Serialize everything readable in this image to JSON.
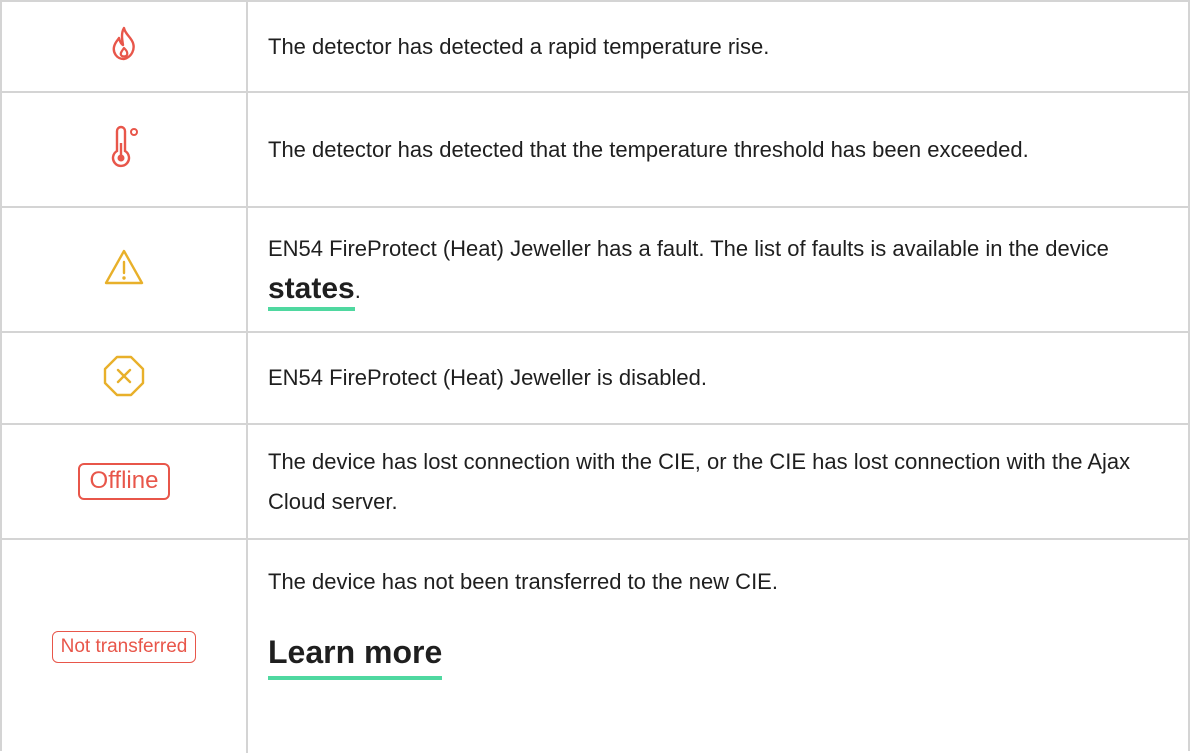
{
  "colors": {
    "red": "#e8564a",
    "yellow": "#e8b02a",
    "link_underline": "#4fd8a0",
    "border": "#d4d4d4"
  },
  "rows": [
    {
      "icon": "flame-icon",
      "text": "The detector has detected a rapid temperature rise."
    },
    {
      "icon": "thermometer-icon",
      "text": "The detector has detected that the temperature threshold has been exceeded."
    },
    {
      "icon": "warning-triangle-icon",
      "text_before": "EN54 FireProtect (Heat) Jeweller has a fault. The list of faults is available in the device ",
      "link": "states",
      "text_after": "."
    },
    {
      "icon": "disabled-octagon-icon",
      "text": "EN54 FireProtect (Heat) Jeweller is disabled."
    },
    {
      "badge": "Offline",
      "text": "The device has lost connection with the CIE, or the CIE has lost connection with the Ajax Cloud server."
    },
    {
      "badge": "Not transferred",
      "text": "The device has not been transferred to the new CIE.",
      "link": "Learn more"
    }
  ]
}
